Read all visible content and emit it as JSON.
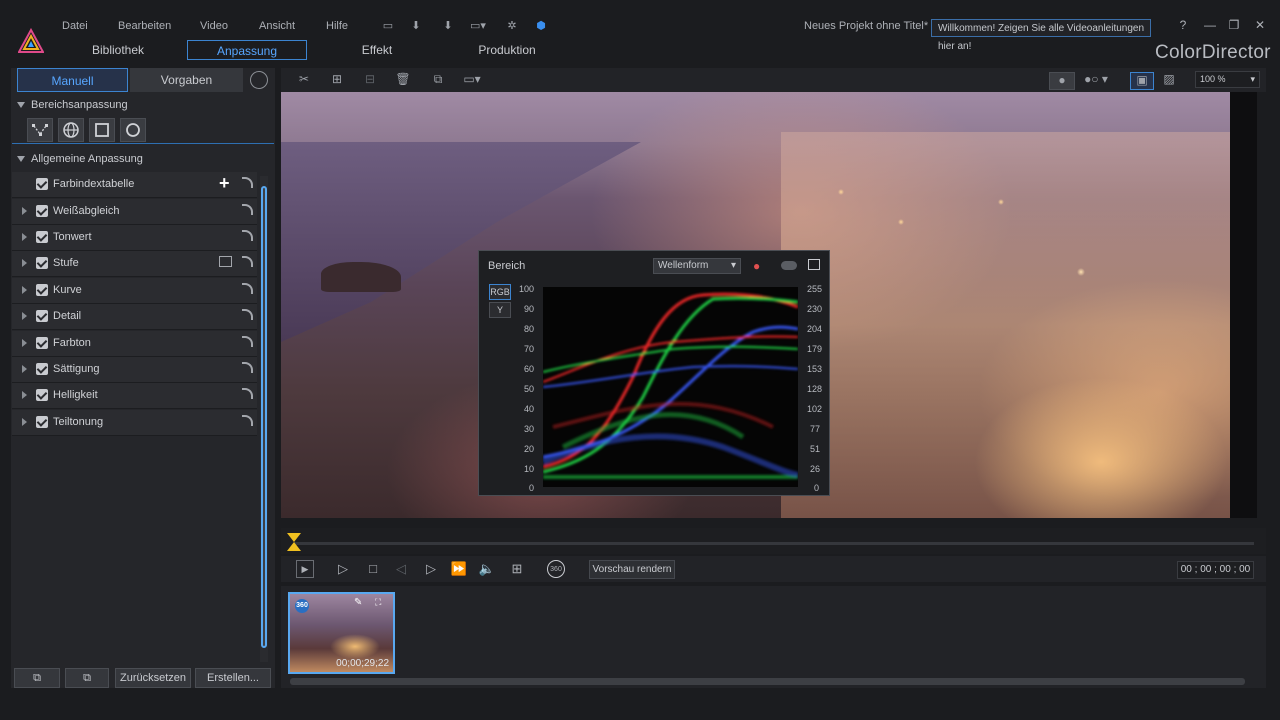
{
  "menu": {
    "items": [
      "Datei",
      "Bearbeiten",
      "Video",
      "Ansicht",
      "Hilfe"
    ],
    "project_title": "Neues Projekt ohne Titel*",
    "welcome_text": "Willkommen! Zeigen Sie alle Videoanleitungen hier an!",
    "brand": "ColorDirector"
  },
  "nav": {
    "tabs": [
      "Bibliothek",
      "Anpassung",
      "Effekt",
      "Produktion"
    ],
    "active": "Anpassung"
  },
  "left_panel": {
    "tabs": [
      "Manuell",
      "Vorgaben"
    ],
    "active_tab": "Manuell",
    "section_area": "Bereichsanpassung",
    "section_general": "Allgemeine Anpassung",
    "items": [
      {
        "label": "Farbindextabelle",
        "checked": true
      },
      {
        "label": "Weißabgleich",
        "checked": true
      },
      {
        "label": "Tonwert",
        "checked": true
      },
      {
        "label": "Stufe",
        "checked": true
      },
      {
        "label": "Kurve",
        "checked": true
      },
      {
        "label": "Detail",
        "checked": true
      },
      {
        "label": "Farbton",
        "checked": true
      },
      {
        "label": "Sättigung",
        "checked": true
      },
      {
        "label": "Helligkeit",
        "checked": true
      },
      {
        "label": "Teiltonung",
        "checked": true
      }
    ],
    "reset_label": "Zurücksetzen",
    "create_label": "Erstellen..."
  },
  "preview": {
    "zoom": "100 %"
  },
  "scope": {
    "title": "Bereich",
    "mode_select": "Wellenform",
    "modes": [
      "RGB",
      "Y"
    ],
    "left_axis": [
      "100",
      "90",
      "80",
      "70",
      "60",
      "50",
      "40",
      "30",
      "20",
      "10",
      "0"
    ],
    "right_axis": [
      "255",
      "230",
      "204",
      "179",
      "153",
      "128",
      "102",
      "77",
      "51",
      "26",
      "0"
    ],
    "colors": {
      "red": "#ff2a2a",
      "green": "#22e04a",
      "blue": "#3a5cff"
    }
  },
  "transport": {
    "render_label": "Vorschau rendern",
    "timecode": "00 ; 00 ; 00 ; 00"
  },
  "media": {
    "clip_duration": "00;00;29;22",
    "badge": "360"
  },
  "colors": {
    "accent": "#3c84d0",
    "accent_text": "#57a6ff",
    "marker": "#f0c020"
  }
}
